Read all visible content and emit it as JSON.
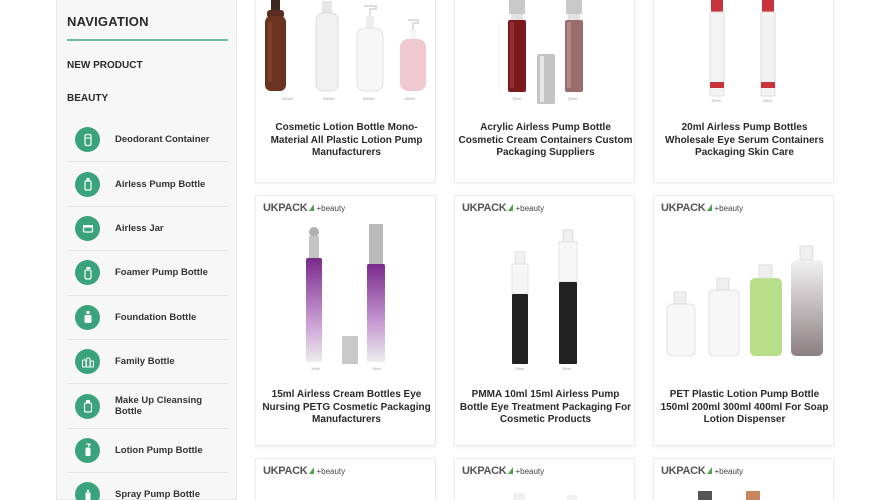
{
  "nav": {
    "title": "NAVIGATION",
    "new_product": "NEW PRODUCT",
    "beauty": "BEAUTY",
    "categories": [
      {
        "label": "Deodorant Container",
        "icon": "deodorant-container-icon"
      },
      {
        "label": "Airless Pump Bottle",
        "icon": "airless-pump-bottle-icon"
      },
      {
        "label": "Airless Jar",
        "icon": "airless-jar-icon"
      },
      {
        "label": "Foamer Pump Bottle",
        "icon": "foamer-pump-bottle-icon"
      },
      {
        "label": "Foundation Bottle",
        "icon": "foundation-bottle-icon"
      },
      {
        "label": "Family Bottle",
        "icon": "family-bottle-icon"
      },
      {
        "label": "Make Up Cleansing Bottle",
        "icon": "cleansing-bottle-icon"
      },
      {
        "label": "Lotion Pump Bottle",
        "icon": "lotion-pump-bottle-icon"
      },
      {
        "label": "Spray Pump Bottle",
        "icon": "spray-pump-bottle-icon"
      }
    ]
  },
  "brand": {
    "name": "UKPACK",
    "suffix": "+beauty"
  },
  "products": [
    {
      "title": "Cosmetic Lotion Bottle Mono-Material All Plastic Lotion Pump Manufacturers"
    },
    {
      "title": "Acrylic Airless Pump Bottle Cosmetic Cream Containers Custom Packaging Suppliers"
    },
    {
      "title": "20ml Airless Pump Bottles Wholesale Eye Serum Containers Packaging Skin Care"
    },
    {
      "title": "15ml Airless Cream Bottles Eye Nursing PETG Cosmetic Packaging Manufacturers"
    },
    {
      "title": "PMMA 10ml 15ml Airless Pump Bottle Eye Treatment Packaging For Cosmetic Products"
    },
    {
      "title": "PET Plastic Lotion Pump Bottle 150ml 200ml 300ml 400ml For Soap Lotion Dispenser"
    }
  ],
  "colors": {
    "accent": "#3aa37e",
    "underline": "#6fb9a6",
    "brand_green": "#4da24a"
  }
}
